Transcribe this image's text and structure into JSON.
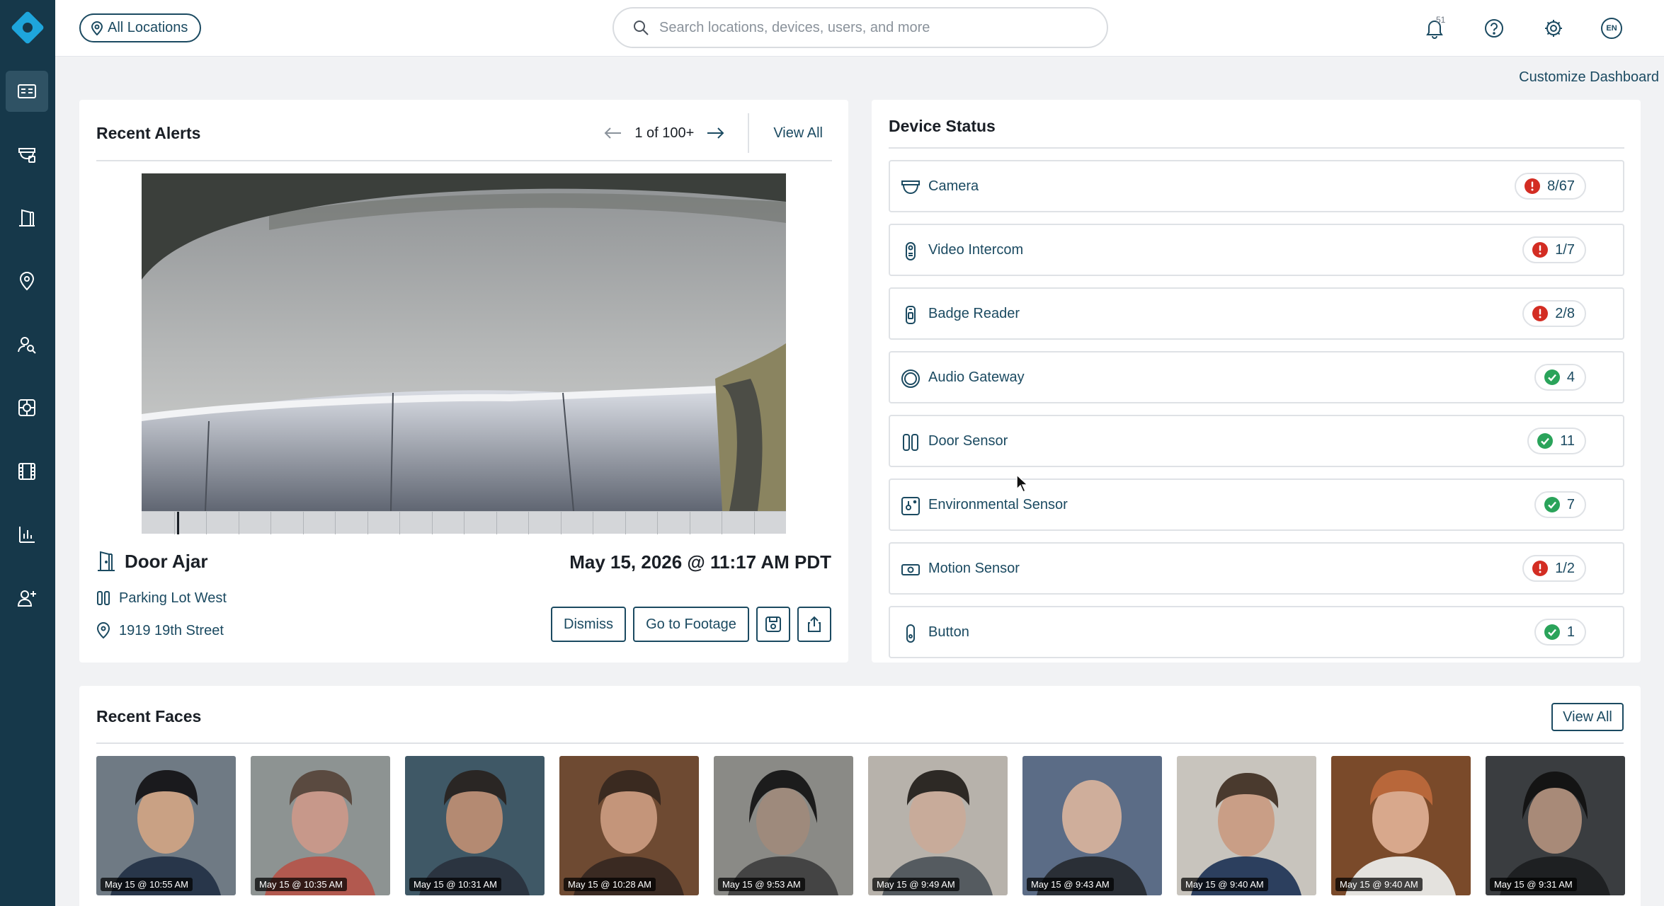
{
  "colors": {
    "sidebar": "#16384a",
    "accent": "#1b4a61",
    "logo": "#1ea5dc",
    "error": "#d32d23",
    "ok": "#2aa35a"
  },
  "sidebar": {
    "items": [
      {
        "icon": "dashboard-icon"
      },
      {
        "icon": "camera-devices-icon"
      },
      {
        "icon": "door-icon"
      },
      {
        "icon": "location-pin-icon"
      },
      {
        "icon": "people-search-icon"
      },
      {
        "icon": "target-icon"
      },
      {
        "icon": "film-icon"
      },
      {
        "icon": "bar-chart-icon"
      },
      {
        "icon": "user-add-icon"
      }
    ]
  },
  "header": {
    "location_label": "All Locations",
    "search_placeholder": "Search locations, devices, users, and more",
    "notification_count": "51",
    "language": "EN"
  },
  "customize_label": "Customize Dashboard",
  "alerts": {
    "title": "Recent Alerts",
    "page_text": "1 of 100+",
    "view_all": "View All",
    "alert_type": "Door Ajar",
    "timestamp": "May 15, 2026 @ 11:17 AM PDT",
    "location_device": "Parking Lot West",
    "address": "1919 19th Street",
    "dismiss": "Dismiss",
    "go_to_footage": "Go to Footage"
  },
  "device_status": {
    "title": "Device Status",
    "items": [
      {
        "label": "Camera",
        "status": "error",
        "count": "8/67"
      },
      {
        "label": "Video Intercom",
        "status": "error",
        "count": "1/7"
      },
      {
        "label": "Badge Reader",
        "status": "error",
        "count": "2/8"
      },
      {
        "label": "Audio Gateway",
        "status": "ok",
        "count": "4"
      },
      {
        "label": "Door Sensor",
        "status": "ok",
        "count": "11"
      },
      {
        "label": "Environmental Sensor",
        "status": "ok",
        "count": "7"
      },
      {
        "label": "Motion Sensor",
        "status": "error",
        "count": "1/2"
      },
      {
        "label": "Button",
        "status": "ok",
        "count": "1"
      }
    ]
  },
  "faces": {
    "title": "Recent Faces",
    "view_all": "View All",
    "items": [
      {
        "time": "May 15 @ 10:55 AM"
      },
      {
        "time": "May 15 @ 10:35 AM"
      },
      {
        "time": "May 15 @ 10:31 AM"
      },
      {
        "time": "May 15 @ 10:28 AM"
      },
      {
        "time": "May 15 @ 9:53 AM"
      },
      {
        "time": "May 15 @ 9:49 AM"
      },
      {
        "time": "May 15 @ 9:43 AM"
      },
      {
        "time": "May 15 @ 9:40 AM"
      },
      {
        "time": "May 15 @ 9:40 AM"
      },
      {
        "time": "May 15 @ 9:31 AM"
      }
    ]
  }
}
